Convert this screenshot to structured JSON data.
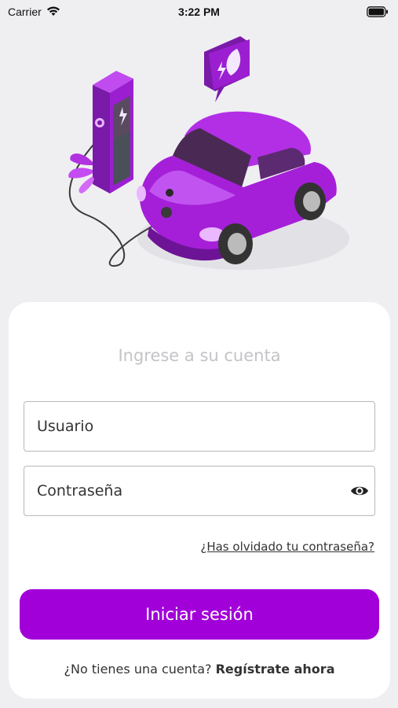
{
  "status_bar": {
    "carrier": "Carrier",
    "time": "3:22 PM"
  },
  "illustration": {
    "description_icons": [
      "charging-station-icon",
      "leaf-icon",
      "electric-car-icon"
    ],
    "accent_color": "#9b1fd1"
  },
  "login": {
    "title": "Ingrese a su cuenta",
    "username_placeholder": "Usuario",
    "password_placeholder": "Contraseña",
    "forgot_password": "¿Has olvidado tu contraseña?",
    "submit_label": "Iniciar sesión",
    "signup_prompt": "¿No tienes una cuenta?",
    "signup_link": "Regístrate ahora"
  },
  "colors": {
    "primary": "#a200d9",
    "background": "#efeff2",
    "card": "#ffffff"
  }
}
